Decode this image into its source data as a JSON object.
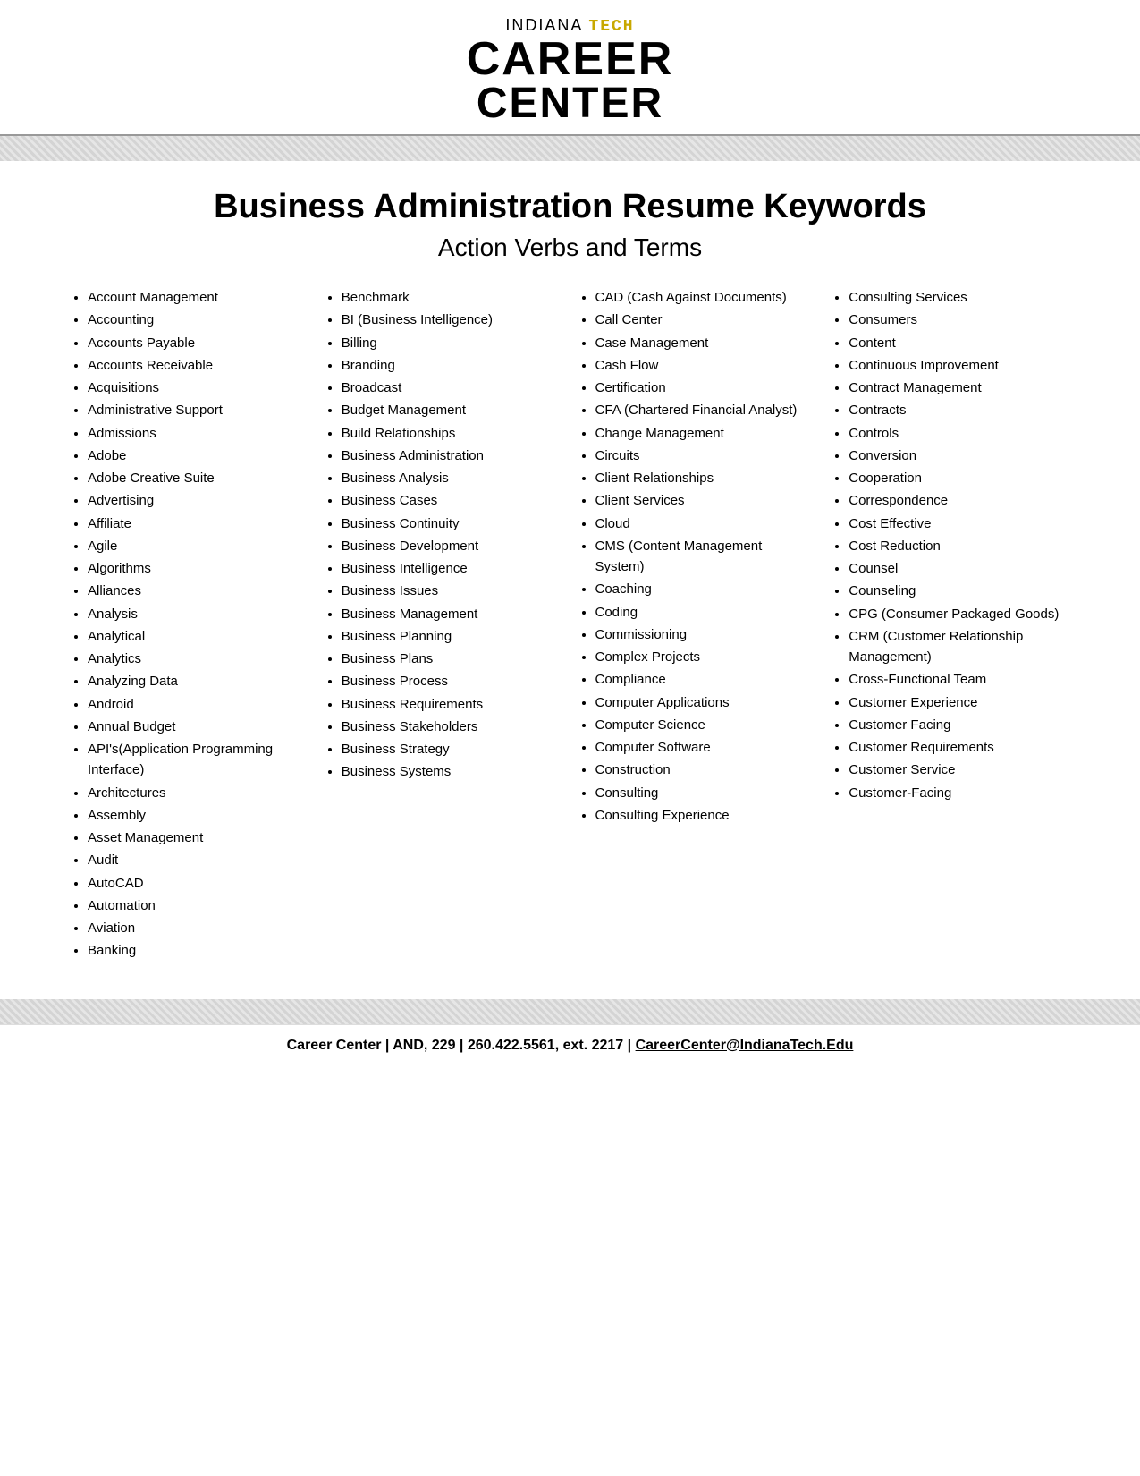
{
  "header": {
    "indiana_label": "INDIANA",
    "tech_label": "TECH",
    "career_label": "CAREER",
    "center_label": "CENTER"
  },
  "page_title": "Business Administration Resume Keywords",
  "section_subtitle": "Action Verbs  and Terms",
  "columns": [
    {
      "items": [
        "Account Management",
        "Accounting",
        "Accounts Payable",
        "Accounts Receivable",
        "Acquisitions",
        "Administrative Support",
        "Admissions",
        "Adobe",
        "Adobe Creative Suite",
        "Advertising",
        "Affiliate",
        "Agile",
        "Algorithms",
        "Alliances",
        "Analysis",
        "Analytical",
        "Analytics",
        "Analyzing Data",
        "Android",
        "Annual Budget",
        "API's(Application Programming Interface)",
        "Architectures",
        "Assembly",
        "Asset Management",
        "Audit",
        "AutoCAD",
        "Automation",
        "Aviation",
        "Banking"
      ]
    },
    {
      "items": [
        "Benchmark",
        "BI (Business Intelligence)",
        "Billing",
        "Branding",
        "Broadcast",
        "Budget Management",
        "Build Relationships",
        "Business Administration",
        "Business Analysis",
        "Business Cases",
        "Business Continuity",
        "Business Development",
        "Business Intelligence",
        "Business Issues",
        "Business Management",
        "Business Planning",
        "Business Plans",
        "Business Process",
        "Business Requirements",
        "Business Stakeholders",
        "Business Strategy",
        "Business Systems"
      ]
    },
    {
      "items": [
        "CAD (Cash Against Documents)",
        "Call Center",
        "Case Management",
        "Cash Flow",
        "Certification",
        "CFA (Chartered Financial Analyst)",
        "Change Management",
        "Circuits",
        "Client Relationships",
        "Client Services",
        "Cloud",
        "CMS (Content Management System)",
        "Coaching",
        "Coding",
        "Commissioning",
        "Complex Projects",
        "Compliance",
        "Computer Applications",
        "Computer Science",
        "Computer Software",
        "Construction",
        "Consulting",
        "Consulting Experience"
      ]
    },
    {
      "items": [
        "Consulting Services",
        "Consumers",
        "Content",
        "Continuous Improvement",
        "Contract Management",
        "Contracts",
        "Controls",
        "Conversion",
        "Cooperation",
        "Correspondence",
        "Cost Effective",
        "Cost Reduction",
        "Counsel",
        "Counseling",
        "CPG (Consumer Packaged Goods)",
        "CRM (Customer Relationship Management)",
        "Cross-Functional Team",
        "Customer Experience",
        "Customer Facing",
        "Customer Requirements",
        "Customer Service",
        "Customer-Facing"
      ]
    }
  ],
  "footer": {
    "text": "Career Center | AND, 229 | 260.422.5561, ext. 2217 | CareerCenter@IndianaTech.Edu"
  }
}
